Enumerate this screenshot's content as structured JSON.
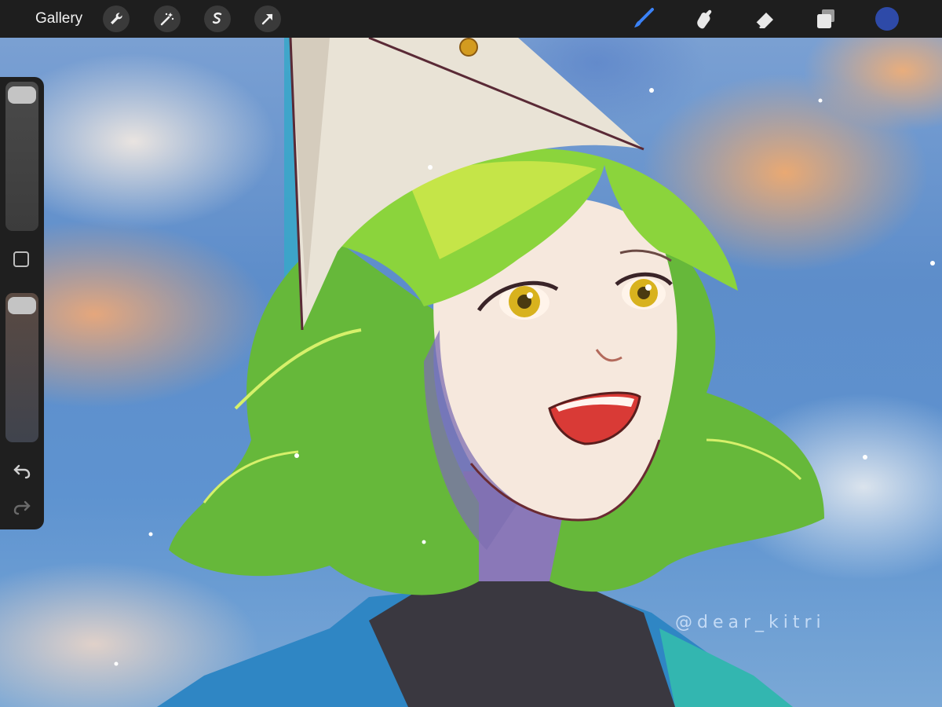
{
  "topbar": {
    "gallery_label": "Gallery",
    "left_tools": [
      "wrench-icon",
      "magic-wand-icon",
      "selection-icon",
      "transform-arrow-icon"
    ],
    "right_tools": [
      "brush-icon",
      "smudge-icon",
      "eraser-icon",
      "layers-icon"
    ],
    "active_tool": "brush",
    "accent_color": "#3b82f6",
    "current_color": "#2e4aa8"
  },
  "sidebar": {
    "brush_size_level": 0.95,
    "opacity_level": 0.95,
    "buttons": [
      "modify-square-icon",
      "undo-icon",
      "redo-icon"
    ]
  },
  "canvas": {
    "watermark": "@dear_kitri"
  }
}
